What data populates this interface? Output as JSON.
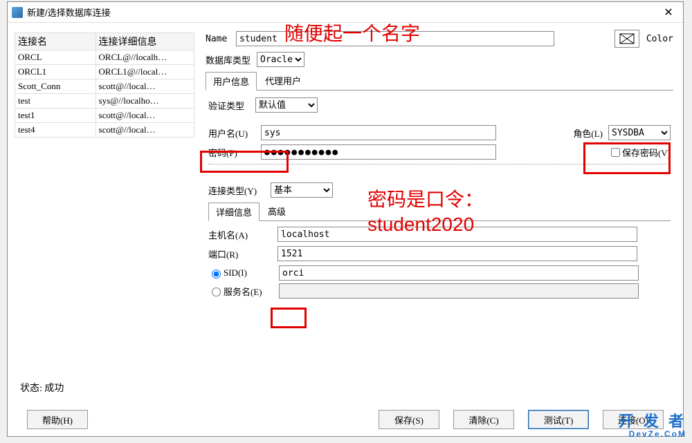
{
  "window": {
    "title": "新建/选择数据库连接",
    "close": "✕"
  },
  "conn_table": {
    "headers": {
      "name": "连接名",
      "detail": "连接详细信息"
    },
    "rows": [
      {
        "name": "ORCL",
        "detail": "ORCL@//localh…"
      },
      {
        "name": "ORCL1",
        "detail": "ORCL1@//local…"
      },
      {
        "name": "Scott_Conn",
        "detail": "scott@//local…"
      },
      {
        "name": "test",
        "detail": "sys@//localho…"
      },
      {
        "name": "test1",
        "detail": "scott@//local…"
      },
      {
        "name": "test4",
        "detail": "scott@//local…"
      }
    ]
  },
  "form": {
    "name_label": "Name",
    "name_value": "student",
    "color_label": "Color",
    "dbtype_label": "数据库类型",
    "dbtype_value": "Oracle",
    "tab_user": "用户信息",
    "tab_proxy": "代理用户",
    "auth_label": "验证类型",
    "auth_value": "默认值",
    "user_label": "用户名(U)",
    "user_value": "sys",
    "role_label": "角色(L)",
    "role_value": "SYSDBA",
    "pwd_label": "密码(P)",
    "pwd_value": "●●●●●●●●●●●",
    "save_pwd": "保存密码(V)",
    "conntype_label": "连接类型(Y)",
    "conntype_value": "基本",
    "tab_detail": "详细信息",
    "tab_advanced": "高级",
    "host_label": "主机名(A)",
    "host_value": "localhost",
    "port_label": "端口(R)",
    "port_value": "1521",
    "sid_label": "SID(I)",
    "sid_value": "orci",
    "service_label": "服务名(E)"
  },
  "annotations": {
    "a1": "随便起一个名字",
    "a2_line1": "密码是口令：",
    "a2_line2": "student2020"
  },
  "status": {
    "label": "状态:",
    "value": "成功"
  },
  "buttons": {
    "help": "帮助(H)",
    "save": "保存(S)",
    "clear": "清除(C)",
    "test": "测试(T)",
    "connect": "连接(O)"
  },
  "watermark": {
    "line1": "开 发 者",
    "line2": "DevZe.CoM"
  }
}
